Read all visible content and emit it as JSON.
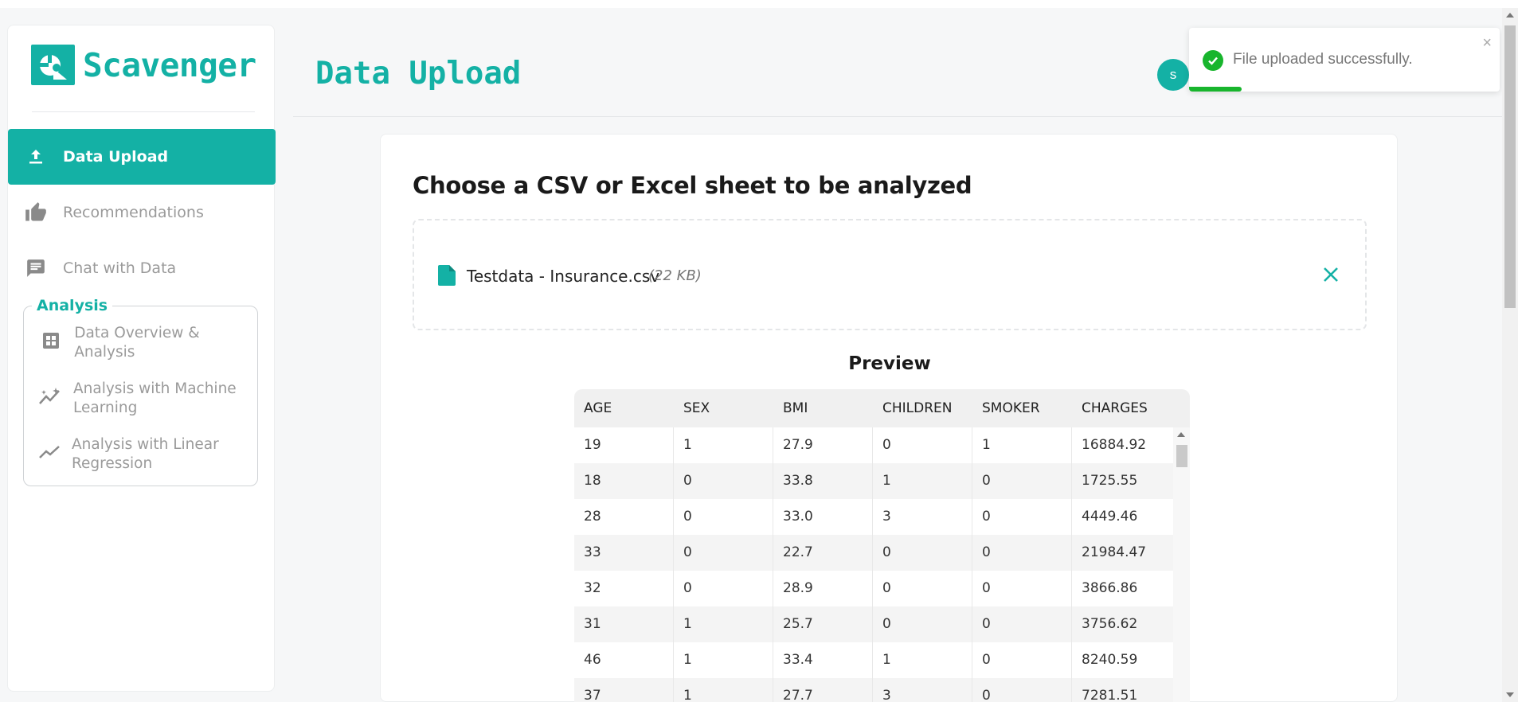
{
  "app": {
    "name": "Scavenger"
  },
  "sidebar": {
    "items": [
      {
        "label": "Data Upload",
        "icon": "upload-icon",
        "active": true
      },
      {
        "label": "Recommendations",
        "icon": "thumbs-up-icon",
        "active": false
      },
      {
        "label": "Chat with Data",
        "icon": "chat-icon",
        "active": false
      }
    ],
    "analysis": {
      "title": "Analysis",
      "items": [
        {
          "label": "Data Overview & Analysis",
          "icon": "grid-icon"
        },
        {
          "label": "Analysis with Machine Learning",
          "icon": "sparkle-trend-icon"
        },
        {
          "label": "Analysis with Linear Regression",
          "icon": "trend-line-icon"
        }
      ]
    }
  },
  "header": {
    "title": "Data Upload",
    "avatar_initial": "s"
  },
  "toast": {
    "message": "File uploaded successfully.",
    "close": "×",
    "progress": 0.17
  },
  "upload": {
    "title": "Choose a CSV or Excel sheet to be analyzed",
    "file_name": "Testdata - Insurance.csv",
    "file_size": "(22 KB)"
  },
  "preview": {
    "title": "Preview",
    "columns": [
      "AGE",
      "SEX",
      "BMI",
      "CHILDREN",
      "SMOKER",
      "CHARGES"
    ],
    "rows": [
      [
        "19",
        "1",
        "27.9",
        "0",
        "1",
        "16884.92"
      ],
      [
        "18",
        "0",
        "33.8",
        "1",
        "0",
        "1725.55"
      ],
      [
        "28",
        "0",
        "33.0",
        "3",
        "0",
        "4449.46"
      ],
      [
        "33",
        "0",
        "22.7",
        "0",
        "0",
        "21984.47"
      ],
      [
        "32",
        "0",
        "28.9",
        "0",
        "0",
        "3866.86"
      ],
      [
        "31",
        "1",
        "25.7",
        "0",
        "0",
        "3756.62"
      ],
      [
        "46",
        "1",
        "33.4",
        "1",
        "0",
        "8240.59"
      ],
      [
        "37",
        "1",
        "27.7",
        "3",
        "0",
        "7281.51"
      ]
    ]
  },
  "colors": {
    "accent": "#14b1a5",
    "success": "#18b52d",
    "muted_text": "#9a9a9a"
  }
}
